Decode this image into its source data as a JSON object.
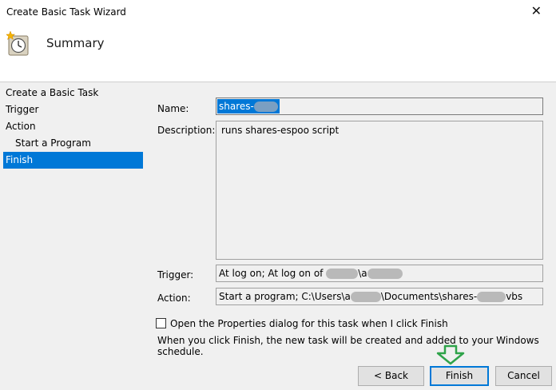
{
  "window": {
    "title": "Create Basic Task Wizard",
    "close_glyph": "✕"
  },
  "header": {
    "page_title": "Summary",
    "icon": "task-scheduler-clock-icon"
  },
  "nav": {
    "items": [
      {
        "label": "Create a Basic Task"
      },
      {
        "label": "Trigger"
      },
      {
        "label": "Action"
      },
      {
        "label": "Start a Program"
      },
      {
        "label": "Finish"
      }
    ],
    "active_index": 4
  },
  "form": {
    "name_label": "Name:",
    "name_value": "shares-",
    "description_label": "Description:",
    "description_value": "runs shares-espoo script",
    "trigger_label": "Trigger:",
    "trigger_value_part1": "At log on; At log on of ",
    "trigger_value_part2": "\\a",
    "action_label": "Action:",
    "action_value_part1": "Start a program; C:\\Users\\a",
    "action_value_part2": "\\Documents\\shares-",
    "action_value_part3": "vbs"
  },
  "options": {
    "open_properties_label": "Open the Properties dialog for this task when I click Finish",
    "open_properties_checked": false,
    "finish_note": "When you click Finish, the new task will be created and added to your Windows schedule."
  },
  "buttons": {
    "back": "< Back",
    "finish": "Finish",
    "cancel": "Cancel"
  },
  "colors": {
    "selection_blue": "#0078d7",
    "arrow_green": "#2fa34a"
  }
}
